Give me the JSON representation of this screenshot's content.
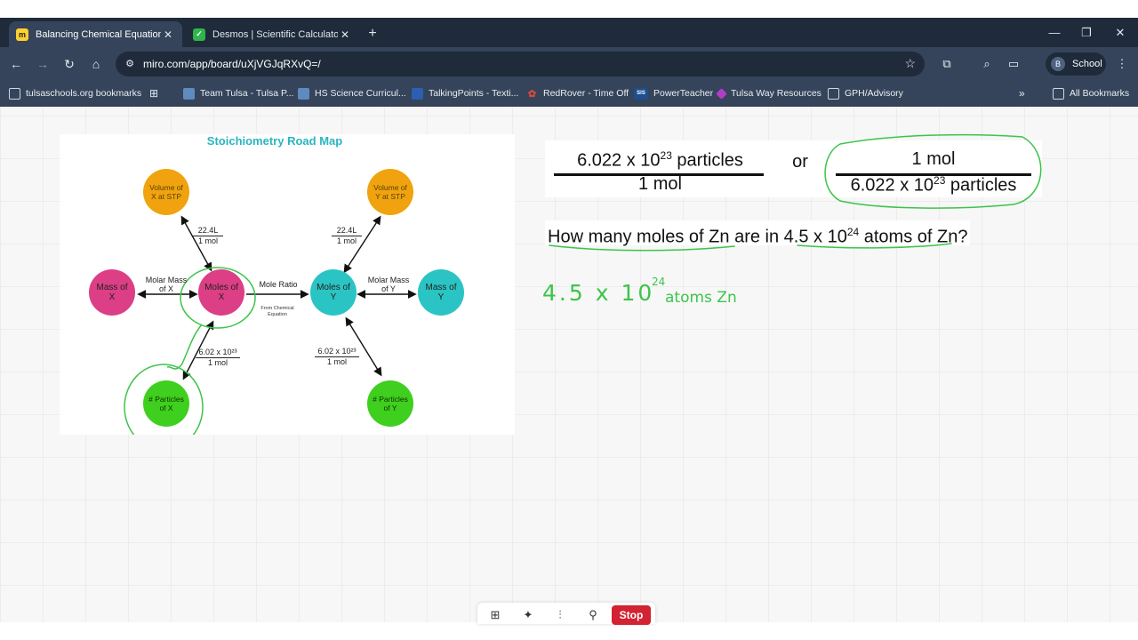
{
  "browser": {
    "tabs": [
      {
        "title": "Balancing Chemical Equations -",
        "favicon": "miro-icon",
        "active": true
      },
      {
        "title": "Desmos | Scientific Calculator",
        "favicon": "desmos-icon",
        "active": false
      }
    ],
    "url": "miro.com/app/board/uXjVGJqRXvQ=/",
    "profile": {
      "initial": "B",
      "label": "School"
    },
    "bookmarks": [
      {
        "label": "tulsaschools.org bookmarks",
        "icon": "folder-icon"
      },
      {
        "label": "Team Tulsa - Tulsa P...",
        "icon": "page-icon"
      },
      {
        "label": "HS Science Curricul...",
        "icon": "page-icon"
      },
      {
        "label": "TalkingPoints - Texti...",
        "icon": "chat-icon"
      },
      {
        "label": "RedRover - Time Off",
        "icon": "redrover-icon"
      },
      {
        "label": "PowerTeacher",
        "icon": "sis-icon"
      },
      {
        "label": "Tulsa Way Resources",
        "icon": "diamond-icon"
      },
      {
        "label": "GPH/Advisory",
        "icon": "folder-icon"
      }
    ],
    "sis_badge": "SIS",
    "all_bookmarks": "All Bookmarks"
  },
  "roadmap": {
    "title": "Stoichiometry Road Map",
    "nodes": {
      "vol_x": "Volume of X at STP",
      "vol_y": "Volume of Y at STP",
      "mass_x": "Mass of X",
      "moles_x": "Moles of X",
      "moles_y": "Moles of Y",
      "mass_y": "Mass of Y",
      "particles_x": "# Particles of X",
      "particles_y": "# Particles of Y"
    },
    "labels": {
      "vol_x_num": "22.4L",
      "vol_x_den": "1 mol",
      "vol_y_num": "22.4L",
      "vol_y_den": "1 mol",
      "molar_mass_x": "Molar Mass of X",
      "mole_ratio": "Mole Ratio",
      "from_equation": "From Chemical Equation",
      "molar_mass_y": "Molar Mass of Y",
      "part_x_num": "6.02 x 10²³",
      "part_x_den": "1 mol",
      "part_y_num": "6.02 x 10²³",
      "part_y_den": "1 mol"
    }
  },
  "formula": {
    "left_num": "6.022 x 10",
    "left_num_exp": "23",
    "left_num_tail": " particles",
    "left_den": "1 mol",
    "or": "or",
    "right_num": "1 mol",
    "right_den": "6.022 x 10",
    "right_den_exp": "23",
    "right_den_tail": " particles"
  },
  "question": {
    "prefix": "How many moles of Zn are in 4.5 x 10",
    "exp": "24",
    "suffix": " atoms of Zn?"
  },
  "handwriting": {
    "main": "4.5 x 10",
    "exp": "24",
    "unit": "atoms Zn"
  },
  "bottom_toolbar": {
    "stop": "Stop"
  },
  "colors": {
    "pink": "#dc3f85",
    "teal": "#2bc4c4",
    "orange": "#f0a30f",
    "green": "#3fcf1e",
    "ink": "#3cc44a",
    "stop": "#d32232"
  }
}
